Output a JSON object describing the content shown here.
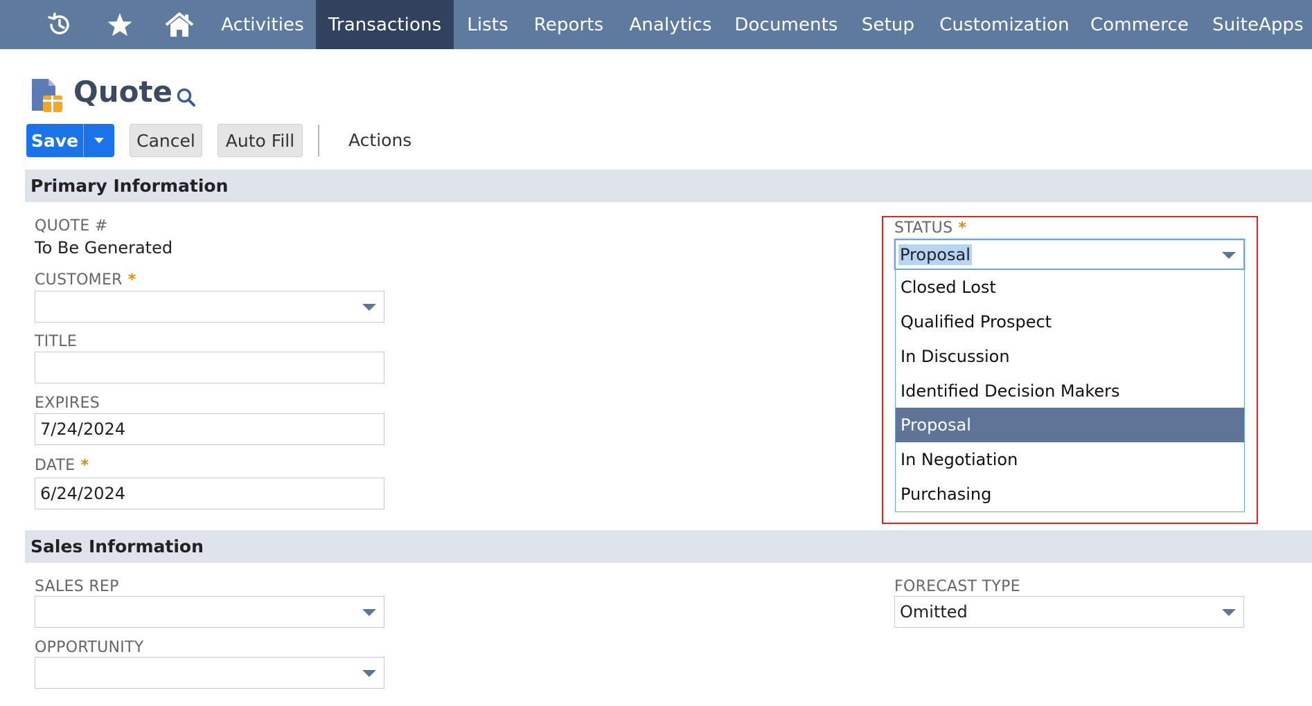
{
  "nav": {
    "icons": [
      "recent-icon",
      "star-icon",
      "home-icon"
    ],
    "items": [
      {
        "label": "Activities",
        "active": false
      },
      {
        "label": "Transactions",
        "active": true
      },
      {
        "label": "Lists",
        "active": false
      },
      {
        "label": "Reports",
        "active": false
      },
      {
        "label": "Analytics",
        "active": false
      },
      {
        "label": "Documents",
        "active": false
      },
      {
        "label": "Setup",
        "active": false
      },
      {
        "label": "Customization",
        "active": false
      },
      {
        "label": "Commerce",
        "active": false
      },
      {
        "label": "SuiteApps",
        "active": false
      }
    ]
  },
  "page": {
    "title": "Quote"
  },
  "toolbar": {
    "save_label": "Save",
    "cancel_label": "Cancel",
    "autofill_label": "Auto Fill",
    "actions_label": "Actions"
  },
  "sections": {
    "primary": "Primary Information",
    "sales": "Sales Information"
  },
  "fields": {
    "quote_number": {
      "label": "QUOTE #",
      "value": "To Be Generated"
    },
    "customer": {
      "label": "CUSTOMER",
      "value": "",
      "required": "*"
    },
    "title": {
      "label": "TITLE",
      "value": ""
    },
    "expires": {
      "label": "EXPIRES",
      "value": "7/24/2024"
    },
    "date": {
      "label": "DATE",
      "value": "6/24/2024",
      "required": "*"
    },
    "status": {
      "label": "STATUS",
      "required": "*",
      "value": "Proposal",
      "options": [
        "Closed Lost",
        "Qualified Prospect",
        "In Discussion",
        "Identified Decision Makers",
        "Proposal",
        "In Negotiation",
        "Purchasing"
      ],
      "selected_index": 4
    },
    "sales_rep": {
      "label": "SALES REP",
      "value": ""
    },
    "opportunity": {
      "label": "OPPORTUNITY",
      "value": ""
    },
    "forecast_type": {
      "label": "FORECAST TYPE",
      "value": "Omitted"
    }
  },
  "colors": {
    "nav_bg": "#5e7a9e",
    "nav_active": "#30425e",
    "primary_button": "#1a73e8",
    "required_star": "#d88f1c",
    "highlight_box": "#e3241b",
    "selected_option": "#5f7597"
  }
}
